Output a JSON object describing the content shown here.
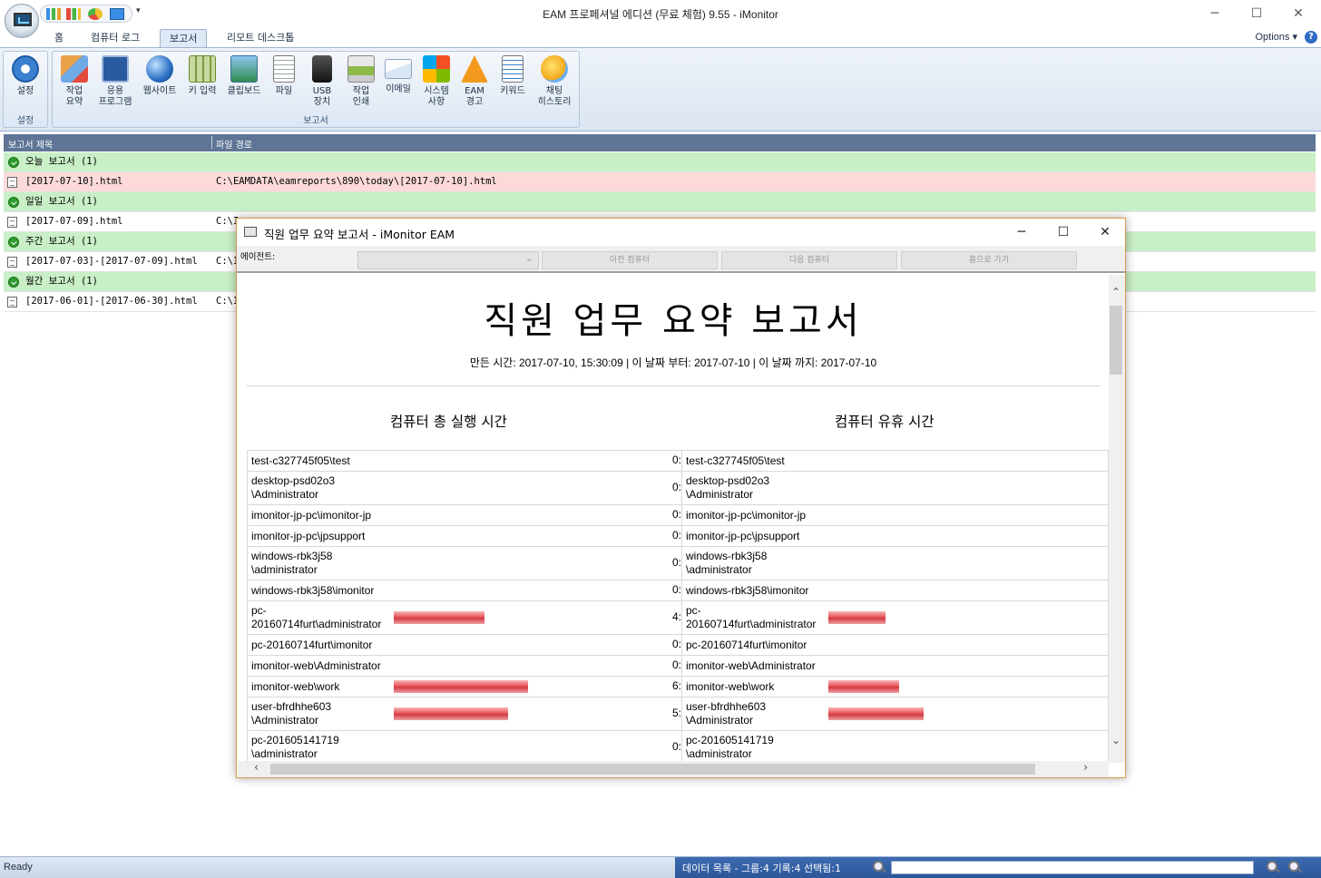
{
  "window": {
    "title": "EAM 프로페셔널 에디션 (무료 체험) 9.55 - iMonitor"
  },
  "tabs": [
    "홈",
    "컴퓨터 로그",
    "보고서",
    "리모트 데스크톱"
  ],
  "options_label": "Options",
  "ribbon": {
    "groups": [
      {
        "label": "설정",
        "buttons": [
          "설정"
        ]
      },
      {
        "label": "보고서",
        "buttons": [
          "작업\n요약",
          "응용\n프로그램",
          "웹사이트",
          "키 입력",
          "클립보드",
          "파일",
          "USB\n장치",
          "작업\n인쇄",
          "이메일",
          "시스템\n사항",
          "EAM\n경고",
          "키워드",
          "채팅\n히스토리"
        ]
      }
    ]
  },
  "list": {
    "headers": [
      "보고서 제목",
      "파일 경로"
    ],
    "rows": [
      {
        "type": "group",
        "title": "오늘 보고서 (1)",
        "path": ""
      },
      {
        "type": "file",
        "title": "[2017-07-10].html",
        "path": "C:\\EAMDATA\\eamreports\\890\\today\\[2017-07-10].html"
      },
      {
        "type": "group",
        "title": "일일 보고서 (1)",
        "path": ""
      },
      {
        "type": "file",
        "title": "[2017-07-09].html",
        "path": "C:\\I"
      },
      {
        "type": "group",
        "title": "주간 보고서 (1)",
        "path": ""
      },
      {
        "type": "file",
        "title": "[2017-07-03]-[2017-07-09].html",
        "path": "C:\\I"
      },
      {
        "type": "group",
        "title": "월간 보고서 (1)",
        "path": ""
      },
      {
        "type": "file",
        "title": "[2017-06-01]-[2017-06-30].html",
        "path": "C:\\I"
      }
    ]
  },
  "status": {
    "left": "Ready",
    "mid": "데이터 목록 - 그룹:4 기록:4 선택됨:1"
  },
  "dialog": {
    "title": "직원 업무 요약 보고서 - iMonitor EAM",
    "agent_label": "에이전트:",
    "prev_button": "이전 컴퓨터",
    "next_button": "다음 컴퓨터",
    "home_button": "홈으로 가기",
    "report_title": "직원 업무 요약 보고서",
    "report_subtitle": "만든 시간: 2017-07-10, 15:30:09 | 이 날짜 부터: 2017-07-10 | 이 날짜 까지: 2017-07-10",
    "col_total": "컴퓨터 총 실행 시간",
    "col_idle": "컴퓨터 유휴 시간",
    "rows": [
      {
        "name": "test-c327745f05\\test",
        "total_num": "0:",
        "total_level": 0,
        "idle_name": "test-c327745f05\\test",
        "idle_level": 0
      },
      {
        "name": "desktop-psd02o3\n\\Administrator",
        "total_num": "0:",
        "total_level": 0,
        "idle_name": "desktop-psd02o3\n\\Administrator",
        "idle_level": 0
      },
      {
        "name": "imonitor-jp-pc\\imonitor-jp",
        "total_num": "0:",
        "total_level": 0,
        "idle_name": "imonitor-jp-pc\\imonitor-jp",
        "idle_level": 0
      },
      {
        "name": "imonitor-jp-pc\\jpsupport",
        "total_num": "0:",
        "total_level": 0,
        "idle_name": "imonitor-jp-pc\\jpsupport",
        "idle_level": 0
      },
      {
        "name": "windows-rbk3j58\n\\administrator",
        "total_num": "0:",
        "total_level": 0,
        "idle_name": "windows-rbk3j58\n\\administrator",
        "idle_level": 0
      },
      {
        "name": "windows-rbk3j58\\imonitor",
        "total_num": "0:",
        "total_level": 0,
        "idle_name": "windows-rbk3j58\\imonitor",
        "idle_level": 0
      },
      {
        "name": "pc-\n20160714furt\\administrator",
        "total_num": "4:",
        "total_level": 0.31,
        "idle_name": "pc-\n20160714furt\\administrator",
        "idle_level": 0.21
      },
      {
        "name": "pc-20160714furt\\imonitor",
        "total_num": "0:",
        "total_level": 0,
        "idle_name": "pc-20160714furt\\imonitor",
        "idle_level": 0
      },
      {
        "name": "imonitor-web\\Administrator",
        "total_num": "0:",
        "total_level": 0,
        "idle_name": "imonitor-web\\Administrator",
        "idle_level": 0
      },
      {
        "name": "imonitor-web\\work",
        "total_num": "6:",
        "total_level": 0.46,
        "idle_name": "imonitor-web\\work",
        "idle_level": 0.26
      },
      {
        "name": "user-bfrdhhe603\n\\Administrator",
        "total_num": "5:",
        "total_level": 0.39,
        "idle_name": "user-bfrdhhe603\n\\Administrator",
        "idle_level": 0.35
      },
      {
        "name": "pc-201605141719\n\\administrator",
        "total_num": "0:",
        "total_level": 0,
        "idle_name": "pc-201605141719\n\\administrator",
        "idle_level": 0
      }
    ]
  },
  "colors": {
    "group_row": "#c9efc6",
    "selected_row": "#fcdada",
    "header_bar": "#5e7595",
    "status_accent": "#2a5599",
    "bar_red": "#d33a41"
  }
}
